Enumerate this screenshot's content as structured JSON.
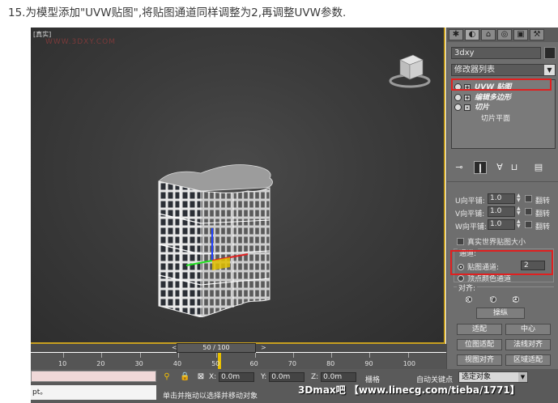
{
  "caption": "15.为模型添加\"UVW贴图\",将贴图通道同样调整为2,再调整UVW参数.",
  "viewport": {
    "label": "[真实]",
    "watermark": "WWW.3DXY.COM"
  },
  "command_panel": {
    "object_name": "3dxy",
    "modifier_list": "修改器列表",
    "stack": [
      {
        "label": "UVW 贴图",
        "expand": "+",
        "highlighted": true
      },
      {
        "label": "编辑多边形",
        "expand": "+"
      },
      {
        "label": "切片",
        "expand": "-"
      }
    ],
    "stack_sub": "切片平面",
    "tiling": [
      {
        "label": "U向平铺:",
        "value": "1.0",
        "flip": "翻转"
      },
      {
        "label": "V向平铺:",
        "value": "1.0",
        "flip": "翻转"
      },
      {
        "label": "W向平铺:",
        "value": "1.0",
        "flip": "翻转"
      }
    ],
    "real_world": "真实世界贴图大小",
    "channel": {
      "title": "通道:",
      "map_channel_label": "贴图通道:",
      "map_channel_value": "2",
      "vertex_color_label": "顶点颜色通道"
    },
    "alignment": {
      "title": "对齐:",
      "x": "X",
      "y": "Y",
      "z": "Z",
      "manipulate": "操纵",
      "fit": "适配",
      "center": "中心",
      "bitmap_fit": "位图适配",
      "normal_align": "法线对齐",
      "view_align": "视图对齐",
      "region_fit": "区域适配"
    }
  },
  "timeline": {
    "frame": "50 / 100",
    "prev": "<",
    "next": ">",
    "ticks": [
      "10",
      "20",
      "30",
      "40",
      "50",
      "60",
      "70",
      "80",
      "90",
      "100"
    ]
  },
  "status": {
    "script": "pt。",
    "help": "单击并拖动以选择并移动对象",
    "x_label": "X:",
    "x_value": "0.0m",
    "y_label": "Y:",
    "y_value": "0.0m",
    "z_label": "Z:",
    "z_value": "0.0m",
    "grid": "栅格",
    "autokey": "自动关键点",
    "selection": "选定对象"
  },
  "footer_watermark": "3Dmax吧 【www.linecg.com/tieba/1771】"
}
